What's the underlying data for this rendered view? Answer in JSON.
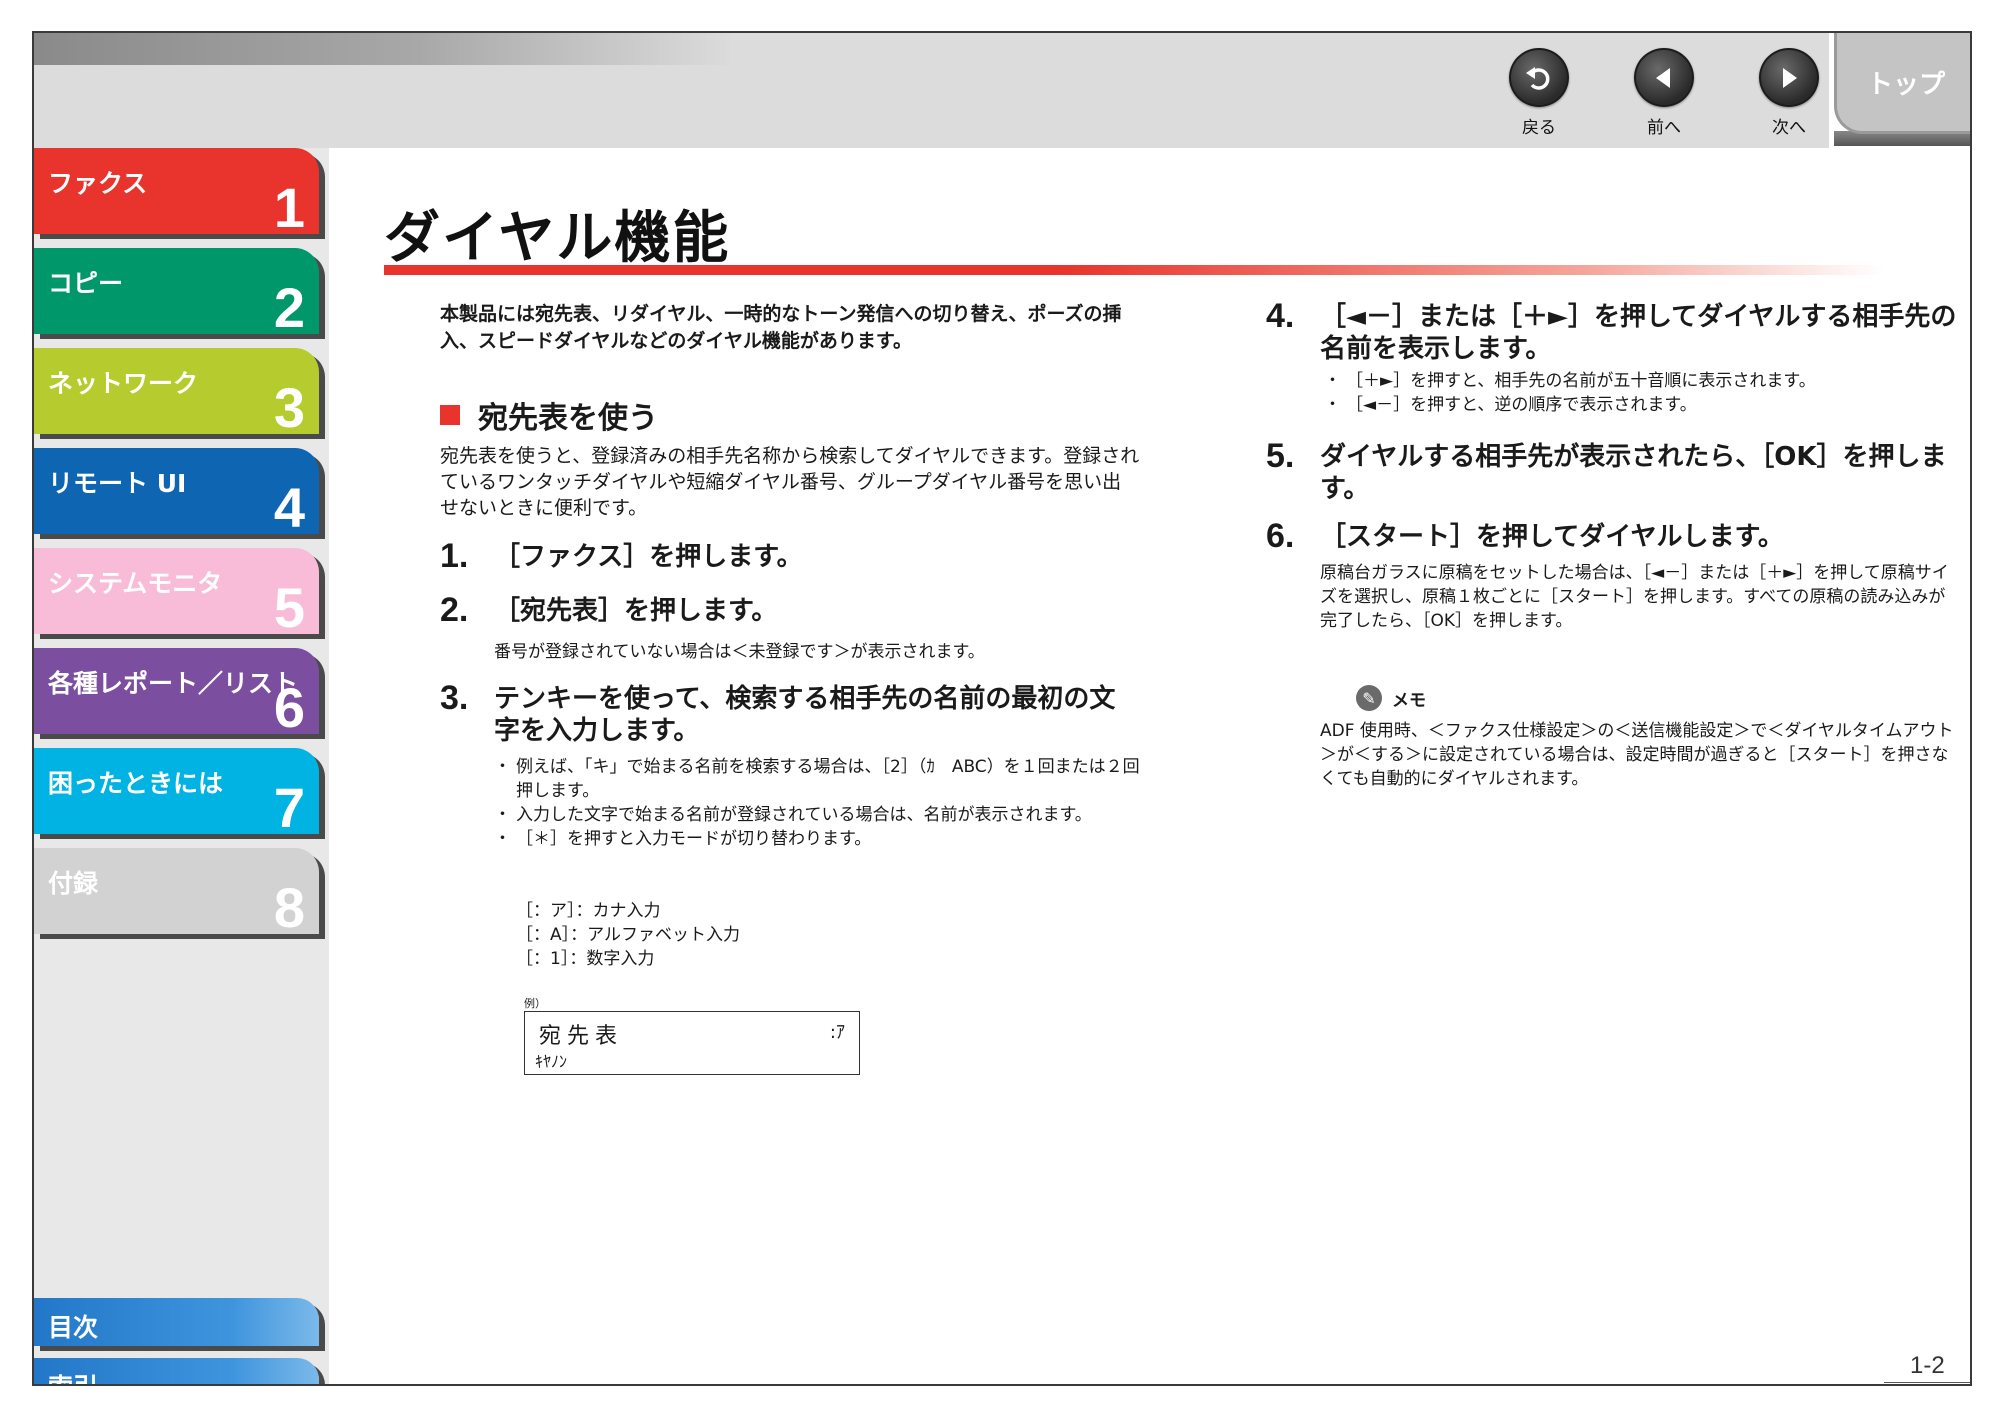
{
  "nav": {
    "back": "戻る",
    "prev": "前へ",
    "next": "次へ",
    "top": "トップ"
  },
  "chapters": [
    {
      "label": "ファクス",
      "num": "1",
      "color": "#e8342c"
    },
    {
      "label": "コピー",
      "num": "2",
      "color": "#00976b"
    },
    {
      "label": "ネットワーク",
      "num": "3",
      "color": "#b6cc2e"
    },
    {
      "label": "リモート UI",
      "num": "4",
      "color": "#0e65b2"
    },
    {
      "label": "システムモニタ",
      "num": "5",
      "color": "#f8bcd8"
    },
    {
      "label": "各種レポート／リスト",
      "num": "6",
      "color": "#7b4ea0"
    },
    {
      "label": "困ったときには",
      "num": "7",
      "color": "#00b3e3"
    },
    {
      "label": "付録",
      "num": "8",
      "color": "#d2d2d2"
    }
  ],
  "links": {
    "toc": "目次",
    "index": "索引"
  },
  "page": {
    "title": "ダイヤル機能",
    "intro": "本製品には宛先表、リダイヤル、一時的なトーン発信への切り替え、ポーズの挿入、スピードダイヤルなどのダイヤル機能があります。",
    "section": "宛先表を使う",
    "section_body": "宛先表を使うと、登録済みの相手先名称から検索してダイヤルできます。登録されているワンタッチダイヤルや短縮ダイヤル番号、グループダイヤル番号を思い出せないときに便利です。",
    "page_number": "1-2"
  },
  "steps": [
    {
      "num": "1.",
      "text": "［ファクス］を押します。"
    },
    {
      "num": "2.",
      "text": "［宛先表］を押します。",
      "note": "番号が登録されていない場合は＜未登録です＞が表示されます。"
    },
    {
      "num": "3.",
      "text": "テンキーを使って、検索する相手先の名前の最初の文字を入力します。",
      "bullets": [
        "例えば、「キ」で始まる名前を検索する場合は、［2］（ｶ　ABC）を１回または２回押します。",
        "入力した文字で始まる名前が登録されている場合は、名前が表示されます。",
        "［＊］を押すと入力モードが切り替わります。"
      ],
      "modes": [
        "［：ア］：カナ入力",
        "［：A］：アルファベット入力",
        "［：1］：数字入力"
      ]
    },
    {
      "num": "4.",
      "text": "［◄－］または［＋►］を押してダイヤルする相手先の名前を表示します。",
      "bullets": [
        "［＋►］を押すと、相手先の名前が五十音順に表示されます。",
        "［◄－］を押すと、逆の順序で表示されます。"
      ]
    },
    {
      "num": "5.",
      "text": "ダイヤルする相手先が表示されたら、［OK］を押します。"
    },
    {
      "num": "6.",
      "text": "［スタート］を押してダイヤルします。",
      "note": "原稿台ガラスに原稿をセットした場合は、［◄－］または［＋►］を押して原稿サイズを選択し、原稿１枚ごとに［スタート］を押します。すべての原稿の読み込みが完了したら、［OK］を押します。"
    }
  ],
  "lcd": {
    "caption": "例）",
    "line1": "宛先表",
    "mode": ":ｱ",
    "line2": "ｷﾔﾉﾝ"
  },
  "memo": {
    "heading": "メモ",
    "body": "ADF 使用時、＜ファクス仕様設定＞の＜送信機能設定＞で＜ダイヤルタイムアウト＞が＜する＞に設定されている場合は、設定時間が過ぎると［スタート］を押さなくても自動的にダイヤルされます。"
  }
}
